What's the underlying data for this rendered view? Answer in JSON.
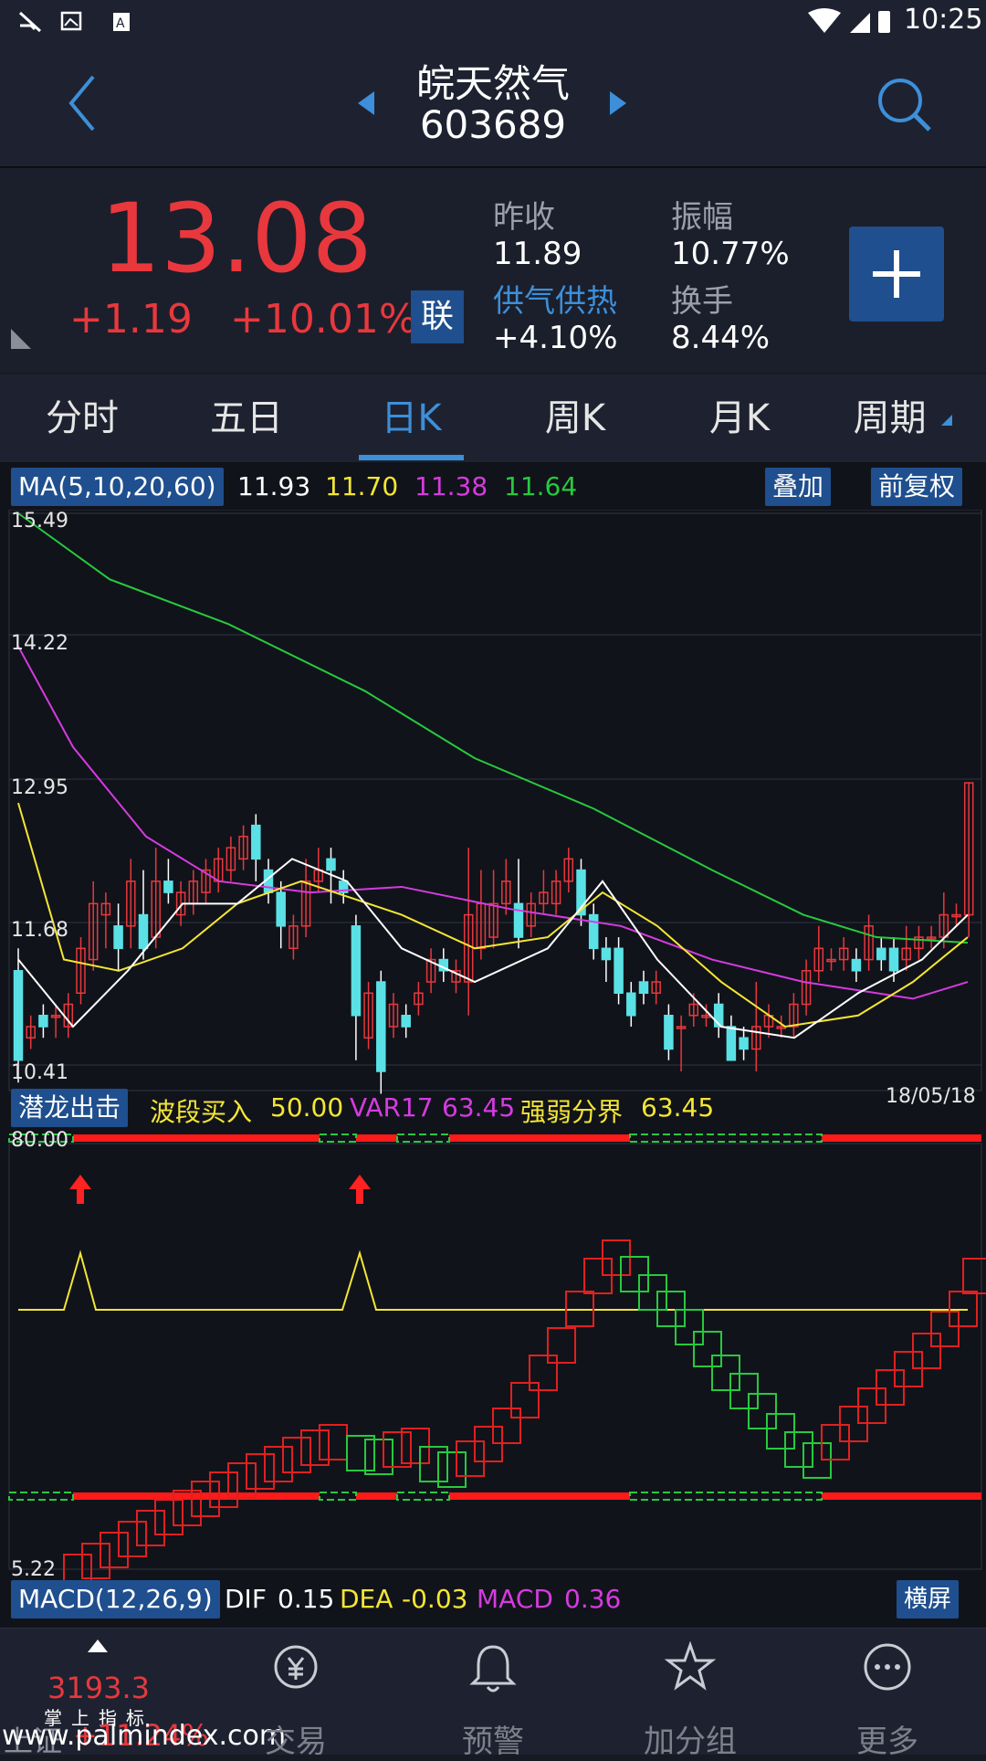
{
  "status": {
    "time": "10:25"
  },
  "header": {
    "name": "皖天然气",
    "code": "603689"
  },
  "quote": {
    "price": "13.08",
    "change": "+1.19",
    "change_pct": "+10.01%",
    "badge": "联",
    "prev_close_label": "昨收",
    "prev_close": "11.89",
    "amplitude_label": "振幅",
    "amplitude": "10.77%",
    "sector_label": "供气供热",
    "sector_pct": "+4.10%",
    "turnover_label": "换手",
    "turnover": "8.44%"
  },
  "tabs": [
    "分时",
    "五日",
    "日K",
    "周K",
    "月K",
    "周期"
  ],
  "main_chart": {
    "indicator": "MA(5,10,20,60)",
    "ma_values": [
      "11.93",
      "11.70",
      "11.38",
      "11.64"
    ],
    "overlay_button": "叠加",
    "adjust_button": "前复权",
    "y_ticks": [
      "15.49",
      "14.22",
      "12.95",
      "11.68",
      "10.41"
    ],
    "date": "18/05/18"
  },
  "sub_chart": {
    "indicator": "潜龙出击",
    "items": [
      {
        "label": "波段买入",
        "value": "50.00"
      },
      {
        "label": "VAR17",
        "value": "63.45"
      },
      {
        "label": "强弱分界",
        "value": "63.45"
      }
    ],
    "top": "80.00",
    "bottom": "5.22"
  },
  "macd": {
    "indicator": "MACD(12,26,9)",
    "dif_label": "DIF",
    "dif": "0.15",
    "dea_label": "DEA",
    "dea": "-0.03",
    "macd_label": "MACD",
    "macd": "0.36",
    "landscape_button": "横屏"
  },
  "bottom_nav": {
    "index_value": "3193.3",
    "index_label": "掌上指标",
    "index_change": "+11.24%",
    "index_name": "上证",
    "watermark": "www.palmindex.com",
    "items": [
      "交易",
      "预警",
      "加分组",
      "更多"
    ]
  },
  "colors": {
    "red": "#e8383d",
    "blue": "#4f9ce8",
    "accent": "#3d8fd9",
    "yellow": "#f3e634",
    "magenta": "#d53be0",
    "green": "#27c93f",
    "cyan": "#5ae1e6"
  }
}
